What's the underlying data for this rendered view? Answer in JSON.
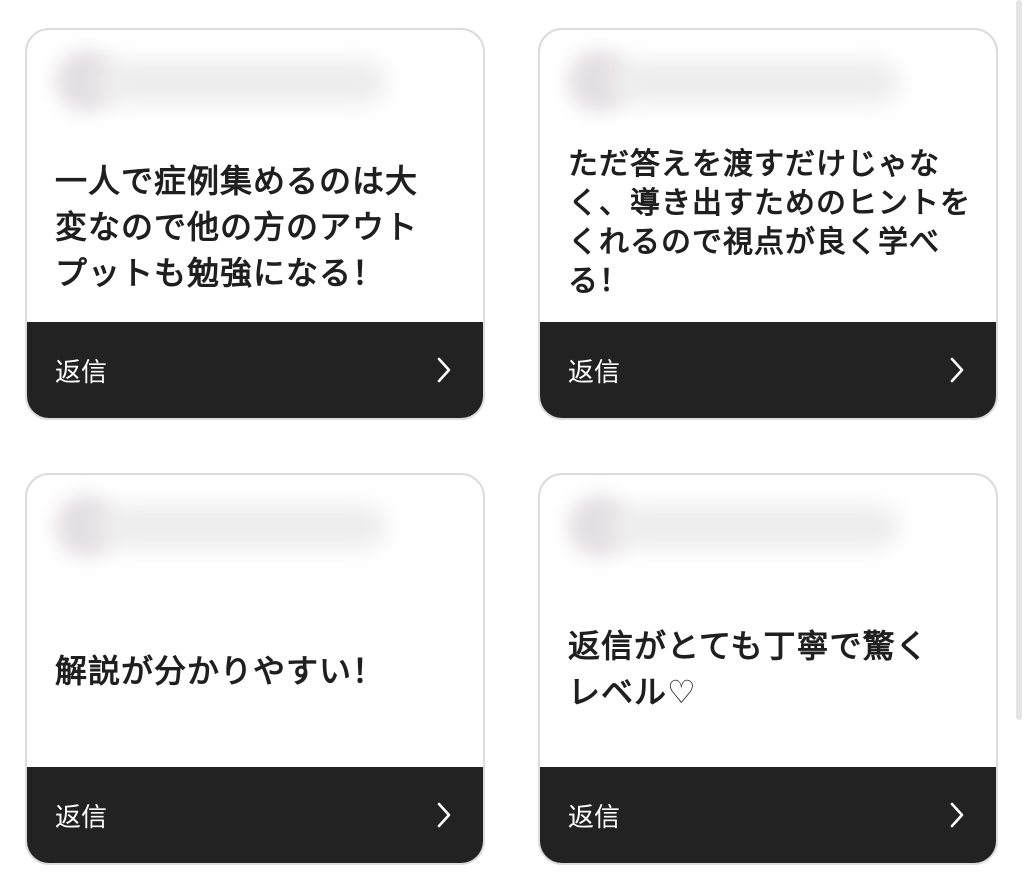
{
  "cards": [
    {
      "message": "一人で症例集めるのは大\n変なので他の方のアウト\nプットも勉強になる！",
      "reply_label": "返信"
    },
    {
      "message": "ただ答えを渡すだけじゃな\nく、導き出すためのヒントを\nくれるので視点が良く学べ\nる！",
      "reply_label": "返信"
    },
    {
      "message": "解説が分かりやすい！",
      "reply_label": "返信"
    },
    {
      "message": "返信がとても丁寧で驚く\nレベル♡",
      "reply_label": "返信"
    }
  ],
  "icons": {
    "reply_arrow": "chevron-right-icon"
  },
  "colors": {
    "reply_bar": "#222222",
    "card_border": "#dcdcdc",
    "text": "#1f1f1f"
  }
}
